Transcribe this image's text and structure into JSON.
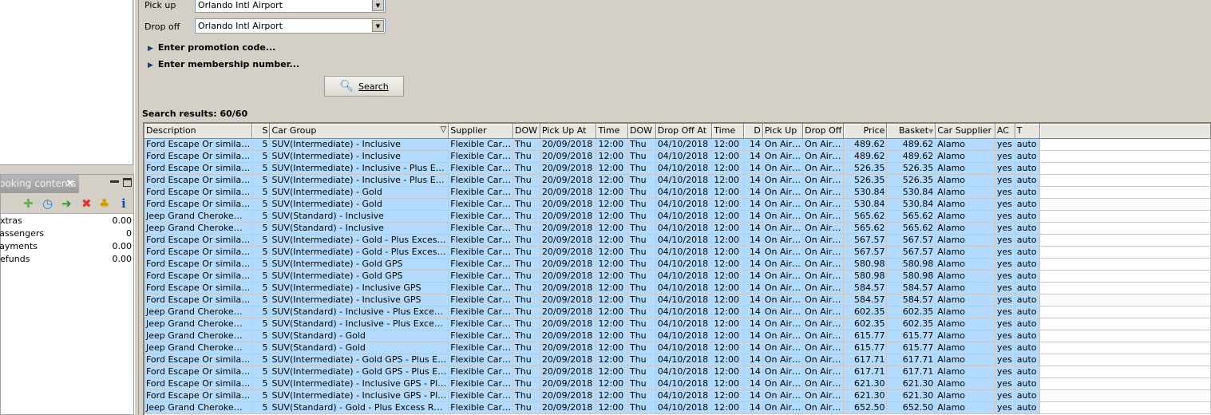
{
  "form": {
    "pickup_label": "Pick up",
    "pickup_value": "Orlando Intl Airport",
    "dropoff_label": "Drop off",
    "dropoff_value": "Orlando Intl Airport",
    "promo": "Enter promotion code...",
    "membership": "Enter membership number...",
    "search_label": "Search"
  },
  "results_label": "Search results: 60/60",
  "panel": {
    "tab": "Booking contents",
    "rows": [
      {
        "label": "Extras",
        "value": "0.00"
      },
      {
        "label": "Passengers",
        "value": "0"
      },
      {
        "label": "Payments",
        "value": "0.00"
      },
      {
        "label": "Refunds",
        "value": "0.00"
      }
    ],
    "toolbar_icons": [
      "add-icon",
      "refresh-clock-icon",
      "cart-transfer-icon",
      "delete-icon",
      "holiday-palm-icon",
      "info-icon"
    ]
  },
  "grid": {
    "columns": [
      "Description",
      "S",
      "Car Group",
      "Supplier",
      "DOW",
      "Pick Up At",
      "Time",
      "DOW",
      "Drop Off At",
      "Time",
      "D",
      "Pick Up",
      "Drop Off",
      "Price",
      "Basket",
      "Car Supplier",
      "AC",
      "T"
    ],
    "filter_column": "Car Group",
    "sort_column": "Basket",
    "rows": [
      [
        "Ford Escape Or simila…",
        "5",
        "SUV(Intermediate) - Inclusive",
        "489.62"
      ],
      [
        "Ford Escape Or simila…",
        "5",
        "SUV(Intermediate) - Inclusive",
        "489.62"
      ],
      [
        "Ford Escape Or simila…",
        "5",
        "SUV(Intermediate) - Inclusive - Plus E…",
        "526.35"
      ],
      [
        "Ford Escape Or simila…",
        "5",
        "SUV(Intermediate) - Inclusive - Plus E…",
        "526.35"
      ],
      [
        "Ford Escape Or simila…",
        "5",
        "SUV(Intermediate) - Gold",
        "530.84"
      ],
      [
        "Ford Escape Or simila…",
        "5",
        "SUV(Intermediate) - Gold",
        "530.84"
      ],
      [
        "Jeep Grand Cheroke…",
        "5",
        "SUV(Standard) - Inclusive",
        "565.62"
      ],
      [
        "Jeep Grand Cheroke…",
        "5",
        "SUV(Standard) - Inclusive",
        "565.62"
      ],
      [
        "Ford Escape Or simila…",
        "5",
        "SUV(Intermediate) - Gold - Plus Exces…",
        "567.57"
      ],
      [
        "Ford Escape Or simila…",
        "5",
        "SUV(Intermediate) - Gold - Plus Exces…",
        "567.57"
      ],
      [
        "Ford Escape Or simila…",
        "5",
        "SUV(Intermediate) - Gold GPS",
        "580.98"
      ],
      [
        "Ford Escape Or simila…",
        "5",
        "SUV(Intermediate) - Gold GPS",
        "580.98"
      ],
      [
        "Ford Escape Or simila…",
        "5",
        "SUV(Intermediate) - Inclusive GPS",
        "584.57"
      ],
      [
        "Ford Escape Or simila…",
        "5",
        "SUV(Intermediate) - Inclusive GPS",
        "584.57"
      ],
      [
        "Jeep Grand Cheroke…",
        "5",
        "SUV(Standard) - Inclusive - Plus Exce…",
        "602.35"
      ],
      [
        "Jeep Grand Cheroke…",
        "5",
        "SUV(Standard) - Inclusive - Plus Exce…",
        "602.35"
      ],
      [
        "Jeep Grand Cheroke…",
        "5",
        "SUV(Standard) - Gold",
        "615.77"
      ],
      [
        "Jeep Grand Cheroke…",
        "5",
        "SUV(Standard) - Gold",
        "615.77"
      ],
      [
        "Ford Escape Or simila…",
        "5",
        "SUV(Intermediate) - Gold GPS - Plus E…",
        "617.71"
      ],
      [
        "Ford Escape Or simila…",
        "5",
        "SUV(Intermediate) - Gold GPS - Plus E…",
        "617.71"
      ],
      [
        "Ford Escape Or simila…",
        "5",
        "SUV(Intermediate) - Inclusive GPS - Pl…",
        "621.30"
      ],
      [
        "Ford Escape Or simila…",
        "5",
        "SUV(Intermediate) - Inclusive GPS - Pl…",
        "621.30"
      ],
      [
        "Jeep Grand Cheroke…",
        "5",
        "SUV(Standard) - Gold - Plus Excess R…",
        "652.50"
      ]
    ],
    "common": {
      "supplier": "Flexible Car…",
      "dow_pick": "Thu",
      "pickup_at": "20/09/2018",
      "time_pick": "12:00",
      "dow_drop": "Thu",
      "dropoff_at": "04/10/2018",
      "time_drop": "12:00",
      "days": "14",
      "pickup": "On Air…",
      "dropoff": "On Air…",
      "car_supplier": "Alamo",
      "ac": "yes",
      "trans": "auto"
    }
  },
  "colors": {
    "row_selected": "#b3dbff",
    "background": "#d4d0c8"
  }
}
